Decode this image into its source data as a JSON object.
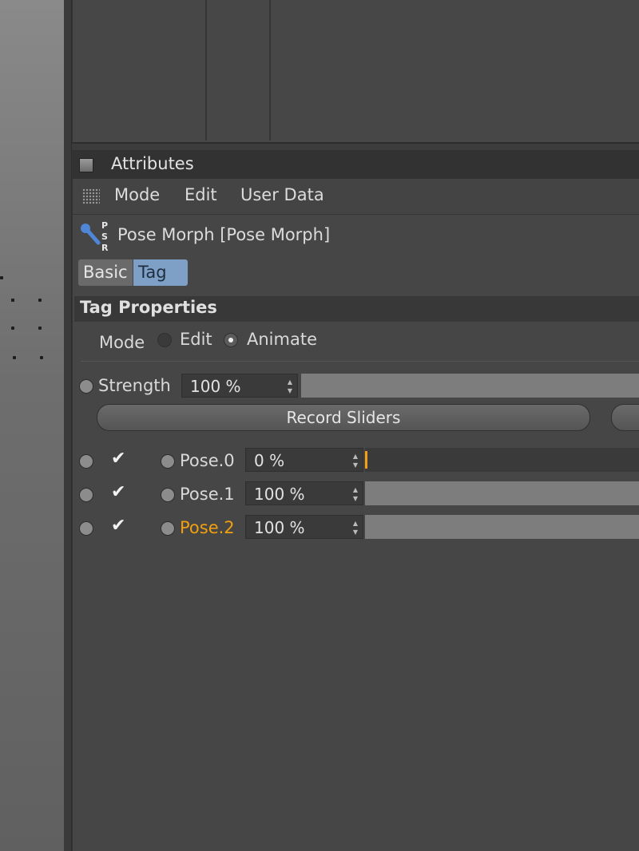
{
  "attributes": {
    "title": "Attributes",
    "menu": [
      "Mode",
      "Edit",
      "User Data"
    ],
    "object": {
      "name": "Pose Morph [Pose Morph]",
      "icon_letters": [
        "P",
        "S",
        "R"
      ]
    },
    "tabs": [
      {
        "label": "Basic",
        "active": false
      },
      {
        "label": "Tag",
        "active": true
      }
    ],
    "section_title": "Tag Properties",
    "mode": {
      "label": "Mode",
      "options": [
        {
          "label": "Edit",
          "selected": false
        },
        {
          "label": "Animate",
          "selected": true
        }
      ]
    },
    "strength": {
      "label": "Strength",
      "value": "100 %",
      "percent": 100
    },
    "record_button": "Record Sliders",
    "poses": [
      {
        "name": "Pose.0",
        "value": "0 %",
        "percent": 0,
        "checked": true,
        "highlight": false
      },
      {
        "name": "Pose.1",
        "value": "100 %",
        "percent": 100,
        "checked": true,
        "highlight": false
      },
      {
        "name": "Pose.2",
        "value": "100 %",
        "percent": 100,
        "checked": true,
        "highlight": true
      }
    ],
    "colors": {
      "highlight": "#f0a010",
      "active_tab": "#7fa0c6"
    }
  }
}
